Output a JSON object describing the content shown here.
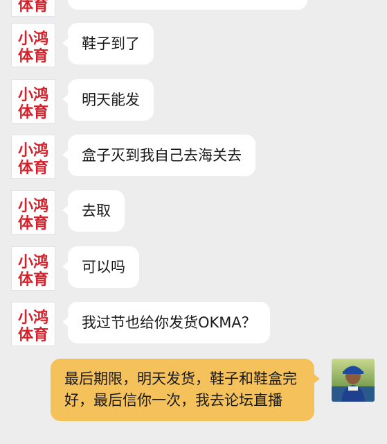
{
  "conversation": {
    "received_messages": [
      {
        "text": "鞋子到了",
        "sender_avatar": "logo-avatar"
      },
      {
        "text": "明天能发",
        "sender_avatar": "logo-avatar"
      },
      {
        "text": "盒子灭到我自己去海关去",
        "sender_avatar": "logo-avatar"
      },
      {
        "text": "去取",
        "sender_avatar": "logo-avatar"
      },
      {
        "text": "可以吗",
        "sender_avatar": "logo-avatar"
      },
      {
        "text": "我过节也给你发货OKMA？",
        "sender_avatar": "logo-avatar"
      }
    ],
    "sent_message": {
      "text": "最后期限，明天发货，鞋子和鞋盒完好，最后信你一次，我去论坛直播",
      "sender_avatar": "user-photo-avatar"
    }
  },
  "avatar_logo": {
    "line1": "小鸿",
    "line2": "体育"
  },
  "colors": {
    "background": "#ededed",
    "incoming_bubble": "#ffffff",
    "outgoing_bubble": "#f5c15a",
    "logo_red": "#d6202a"
  }
}
